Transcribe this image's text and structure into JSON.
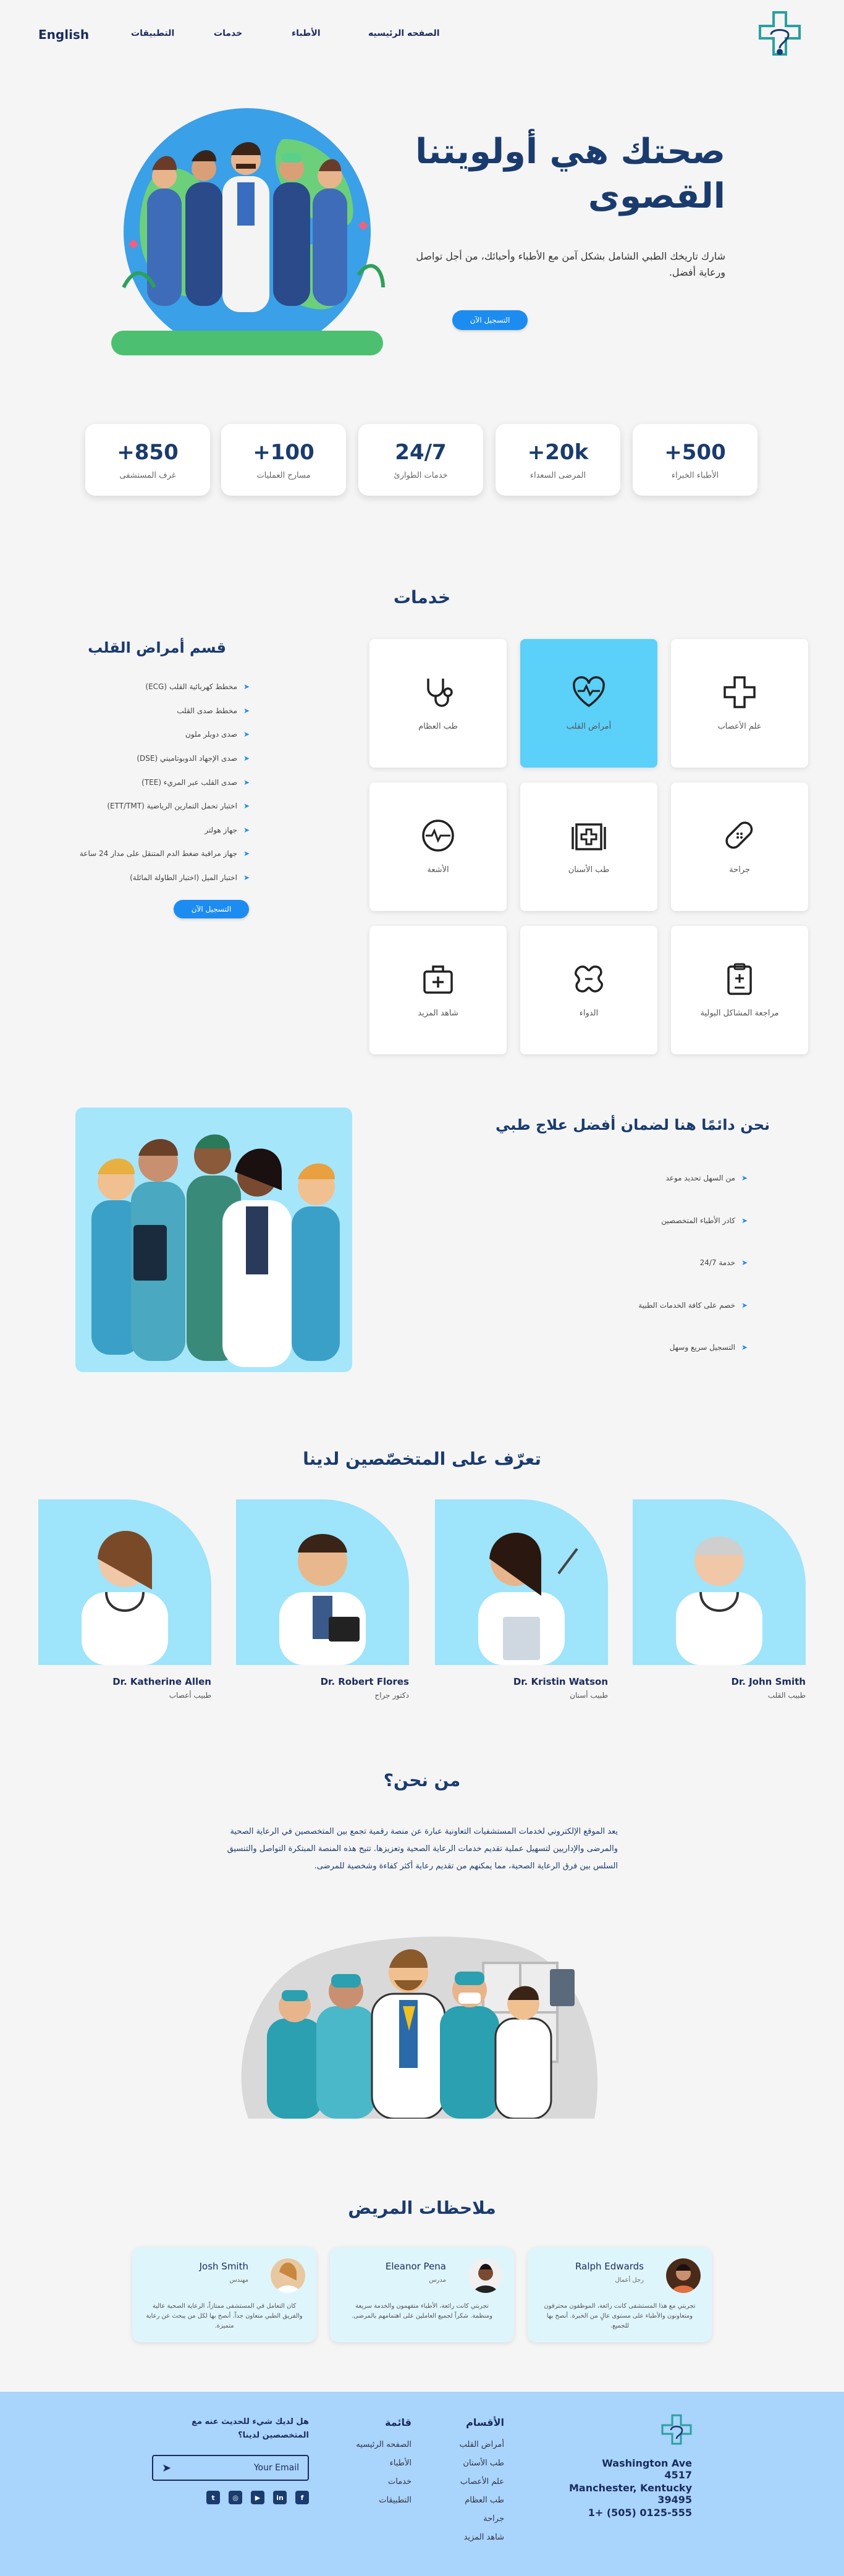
{
  "nav": {
    "lang": "English",
    "links": [
      "التطبيقات",
      "خدمات",
      "الأطباء",
      "الصفحه الرئيسيه"
    ]
  },
  "hero": {
    "title": "صحتك هي أولويتنا القصوى",
    "subtitle": "شارك تاريخك الطبي الشامل بشكل آمن مع الأطباء وأحبائك، من أجل تواصل ورعاية أفضل.",
    "button": "التسجيل الآن"
  },
  "stats": [
    {
      "num": "+850",
      "label": "غرف المستشفى"
    },
    {
      "num": "+100",
      "label": "مسارح العمليات"
    },
    {
      "num": "24/7",
      "label": "خدمات الطوارئ"
    },
    {
      "num": "+20k",
      "label": "المرضى السعداء"
    },
    {
      "num": "+500",
      "label": "الأطباء الخبراء"
    }
  ],
  "services": {
    "title": "خدمات",
    "items": [
      {
        "label": "طب العظام",
        "icon": "stethoscope-icon"
      },
      {
        "label": "أمراض القلب",
        "icon": "heart-pulse-icon"
      },
      {
        "label": "علم الأعصاب",
        "icon": "plus-icon"
      },
      {
        "label": "الأشعة",
        "icon": "pulse-circle-icon"
      },
      {
        "label": "طب الأسنان",
        "icon": "hospital-icon"
      },
      {
        "label": "جراحة",
        "icon": "bandage-icon"
      },
      {
        "label": "شاهد المزيد",
        "icon": "medical-bag-icon"
      },
      {
        "label": "الدواء",
        "icon": "pill-icon"
      },
      {
        "label": "مراجعة المشاكل البولية",
        "icon": "clipboard-icon"
      }
    ],
    "active_index": 1
  },
  "department": {
    "title": "قسم أمراض القلب",
    "items": [
      "مخطط كهربائية القلب (ECG)",
      "مخطط صدى القلب",
      "صدى دوبلر ملون",
      "صدى الإجهاد الدوبوتاميني (DSE)",
      "صدى القلب عبر المريء (TEE)",
      "اختبار تحمل التمارين الرياضية (ETT/TMT)",
      "جهاز هولتر",
      "جهاز مراقبة ضغط الدم المتنقل على مدار 24 ساعة",
      "اختبار الميل (اختبار الطاولة المائلة)"
    ],
    "button": "التسجيل الآن"
  },
  "care": {
    "title": "نحن دائمًا هنا لضمان أفضل علاج طبي",
    "items": [
      "من السهل تحديد موعد",
      "كادر الأطباء المتخصصين",
      "خدمة 24/7",
      "خصم على كافة الخدمات الطبية",
      "التسجيل سريع وسهل"
    ]
  },
  "specialists": {
    "title": "تعرّف على المتخصّصين لدينا",
    "doctors": [
      {
        "name": "Dr. Katherine Allen",
        "role": "طبيب أعصاب"
      },
      {
        "name": "Dr. Robert Flores",
        "role": "دكتور جراح"
      },
      {
        "name": "Dr. Kristin Watson",
        "role": "طبيب أسنان"
      },
      {
        "name": "Dr. John Smith",
        "role": "طبيب القلب"
      }
    ]
  },
  "about": {
    "title": "من نحن؟",
    "text": "يعد الموقع الإلكتروني لخدمات المستشفيات التعاونية عبارة عن منصة رقمية تجمع بين المتخصصين في الرعاية الصحية والمرضى والإداريين لتسهيل عملية تقديم خدمات الرعاية الصحية وتعزيزها. تتيح هذه المنصة المبتكرة التواصل والتنسيق السلس بين فرق الرعاية الصحية، مما يمكنهم من تقديم رعاية أكثر كفاءة وشخصية للمرضى."
  },
  "reviews": {
    "title": "ملاحظات المريض",
    "items": [
      {
        "name": "Josh Smith",
        "role": "مهندس",
        "text": "كان التعامل في المستشفى ممتازاً، الرعاية الصحية عالية والفريق الطبي متعاون جداً. أنصح بها لكل من يبحث عن رعاية متميزة."
      },
      {
        "name": "Eleanor Pena",
        "role": "مدرس",
        "text": "تجربتي كانت رائعة، الأطباء متفهمون والخدمة سريعة ومنظمة. شكراً لجميع العاملين على اهتمامهم بالمرضى."
      },
      {
        "name": "Ralph Edwards",
        "role": "رجل أعمال",
        "text": "تجربتي مع هذا المستشفى كانت رائعة، الموظفون محترفون ومتعاونون والأطباء على مستوى عالٍ من الخبرة. أنصح بها للجميع."
      }
    ]
  },
  "footer": {
    "address": [
      "Washington Ave 4517",
      "Manchester, Kentucky 39495",
      "1+ (505) 0125-555"
    ],
    "sections_head": "الأقسام",
    "sections": [
      "أمراض القلب",
      "طب الأسنان",
      "علم الأعصاب",
      "طب العظام",
      "جراحة",
      "شاهد المزيد"
    ],
    "menu_head": "قائمة",
    "menu": [
      "الصفحه الرئيسيه",
      "الأطباء",
      "خدمات",
      "التطبيقات"
    ],
    "newsletter": "هل لديك شيء للحديث عنه مع المتخصصين لدينا؟",
    "email_placeholder": "Your Email",
    "socials": [
      "facebook-icon",
      "linkedin-icon",
      "youtube-icon",
      "instagram-icon",
      "twitter-icon"
    ]
  },
  "colors": {
    "primary": "#1a3b6e",
    "accent": "#1d8cf0",
    "light_blue": "#5bd0f8",
    "footer": "#a9d4fb"
  }
}
